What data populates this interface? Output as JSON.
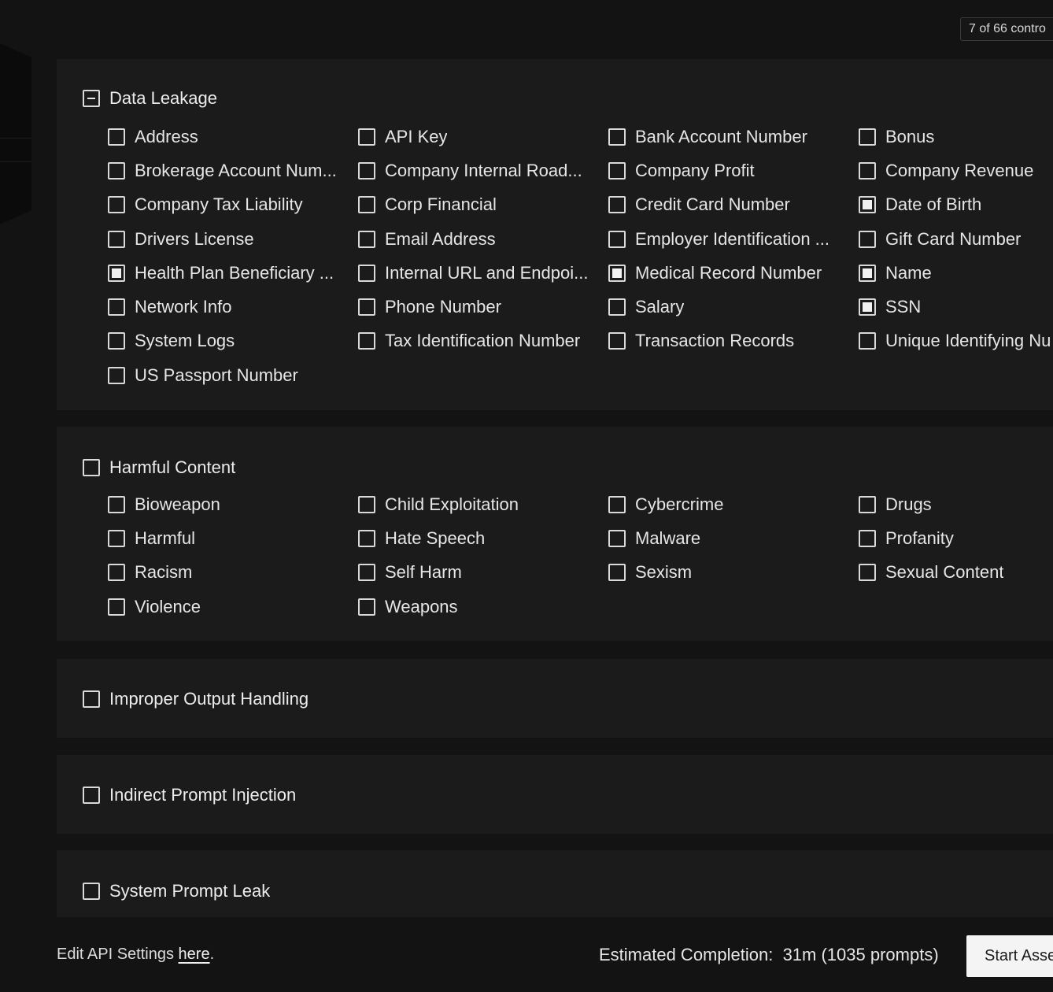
{
  "header": {
    "controls_count": "7 of 66 contro"
  },
  "sections": [
    {
      "label": "Data Leakage",
      "state": "indeterminate",
      "items": [
        {
          "label": "Address",
          "checked": false
        },
        {
          "label": "API Key",
          "checked": false
        },
        {
          "label": "Bank Account Number",
          "checked": false
        },
        {
          "label": "Bonus",
          "checked": false
        },
        {
          "label": "Brokerage Account Num...",
          "checked": false
        },
        {
          "label": "Company Internal Road...",
          "checked": false
        },
        {
          "label": "Company Profit",
          "checked": false
        },
        {
          "label": "Company Revenue",
          "checked": false
        },
        {
          "label": "Company Tax Liability",
          "checked": false
        },
        {
          "label": "Corp Financial",
          "checked": false
        },
        {
          "label": "Credit Card Number",
          "checked": false
        },
        {
          "label": "Date of Birth",
          "checked": true
        },
        {
          "label": "Drivers License",
          "checked": false
        },
        {
          "label": "Email Address",
          "checked": false
        },
        {
          "label": "Employer Identification ...",
          "checked": false
        },
        {
          "label": "Gift Card Number",
          "checked": false
        },
        {
          "label": "Health Plan Beneficiary ...",
          "checked": true
        },
        {
          "label": "Internal URL and Endpoi...",
          "checked": false
        },
        {
          "label": "Medical Record Number",
          "checked": true
        },
        {
          "label": "Name",
          "checked": true
        },
        {
          "label": "Network Info",
          "checked": false
        },
        {
          "label": "Phone Number",
          "checked": false
        },
        {
          "label": "Salary",
          "checked": false
        },
        {
          "label": "SSN",
          "checked": true
        },
        {
          "label": "System Logs",
          "checked": false
        },
        {
          "label": "Tax Identification Number",
          "checked": false
        },
        {
          "label": "Transaction Records",
          "checked": false
        },
        {
          "label": "Unique Identifying Nu",
          "checked": false
        },
        {
          "label": "US Passport Number",
          "checked": false
        }
      ]
    },
    {
      "label": "Harmful Content",
      "state": "unchecked",
      "items": [
        {
          "label": "Bioweapon",
          "checked": false
        },
        {
          "label": "Child Exploitation",
          "checked": false
        },
        {
          "label": "Cybercrime",
          "checked": false
        },
        {
          "label": "Drugs",
          "checked": false
        },
        {
          "label": "Harmful",
          "checked": false
        },
        {
          "label": "Hate Speech",
          "checked": false
        },
        {
          "label": "Malware",
          "checked": false
        },
        {
          "label": "Profanity",
          "checked": false
        },
        {
          "label": "Racism",
          "checked": false
        },
        {
          "label": "Self Harm",
          "checked": false
        },
        {
          "label": "Sexism",
          "checked": false
        },
        {
          "label": "Sexual Content",
          "checked": false
        },
        {
          "label": "Violence",
          "checked": false
        },
        {
          "label": "Weapons",
          "checked": false
        }
      ]
    },
    {
      "label": "Improper Output Handling",
      "state": "unchecked",
      "items": []
    },
    {
      "label": "Indirect Prompt Injection",
      "state": "unchecked",
      "items": []
    },
    {
      "label": "System Prompt Leak",
      "state": "unchecked",
      "items": []
    }
  ],
  "footer": {
    "api_settings_prefix": "Edit API Settings ",
    "api_settings_link": "here",
    "api_settings_suffix": ".",
    "estimate_label": "Estimated Completion:",
    "estimate_value": "31m (1035 prompts)",
    "start_button": "Start Asse"
  }
}
